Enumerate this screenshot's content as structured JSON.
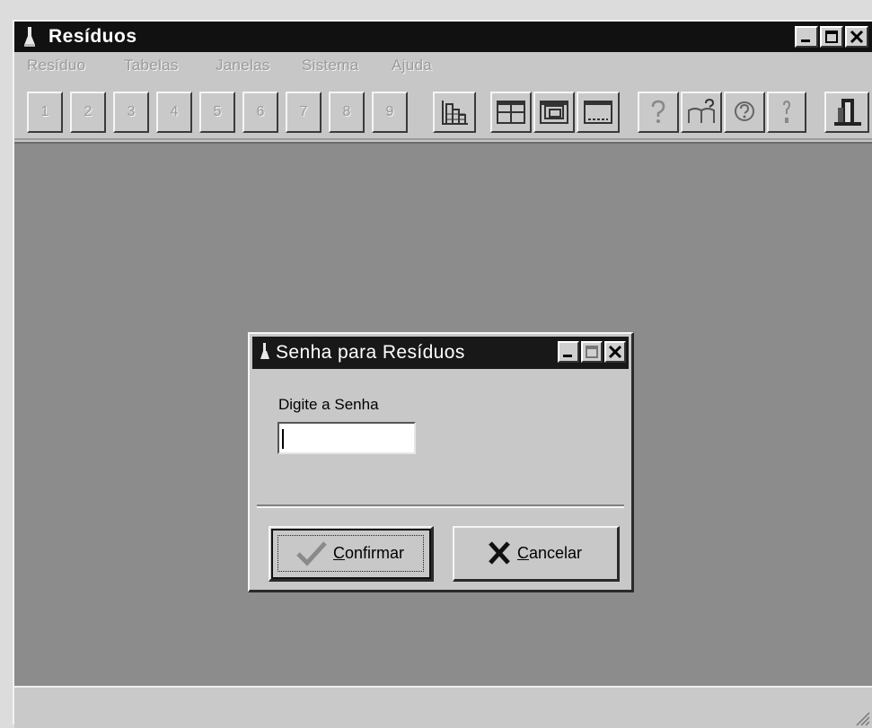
{
  "window": {
    "title": "Resíduos",
    "menu": [
      "Resíduo",
      "Tabelas",
      "Janelas",
      "Sistema",
      "Ajuda"
    ]
  },
  "toolbar": {
    "numbered": [
      "1",
      "2",
      "3",
      "4",
      "5",
      "6",
      "7",
      "8",
      "9"
    ],
    "icons": [
      "grid-chart-icon",
      "tile-windows-icon",
      "cascade-windows-icon",
      "minimize-windows-icon",
      "help-icon",
      "help-index-icon",
      "help-search-icon",
      "about-icon",
      "exit-icon"
    ]
  },
  "dialog": {
    "title": "Senha para Resíduos",
    "prompt": "Digite a Senha",
    "password_value": "",
    "confirm": {
      "first": "C",
      "rest": "onfirmar"
    },
    "cancel": {
      "first": "C",
      "rest": "ancelar"
    }
  },
  "colors": {
    "title_bar": "#111111",
    "workspace": "#8c8c8c",
    "face": "#c8c8c8"
  }
}
